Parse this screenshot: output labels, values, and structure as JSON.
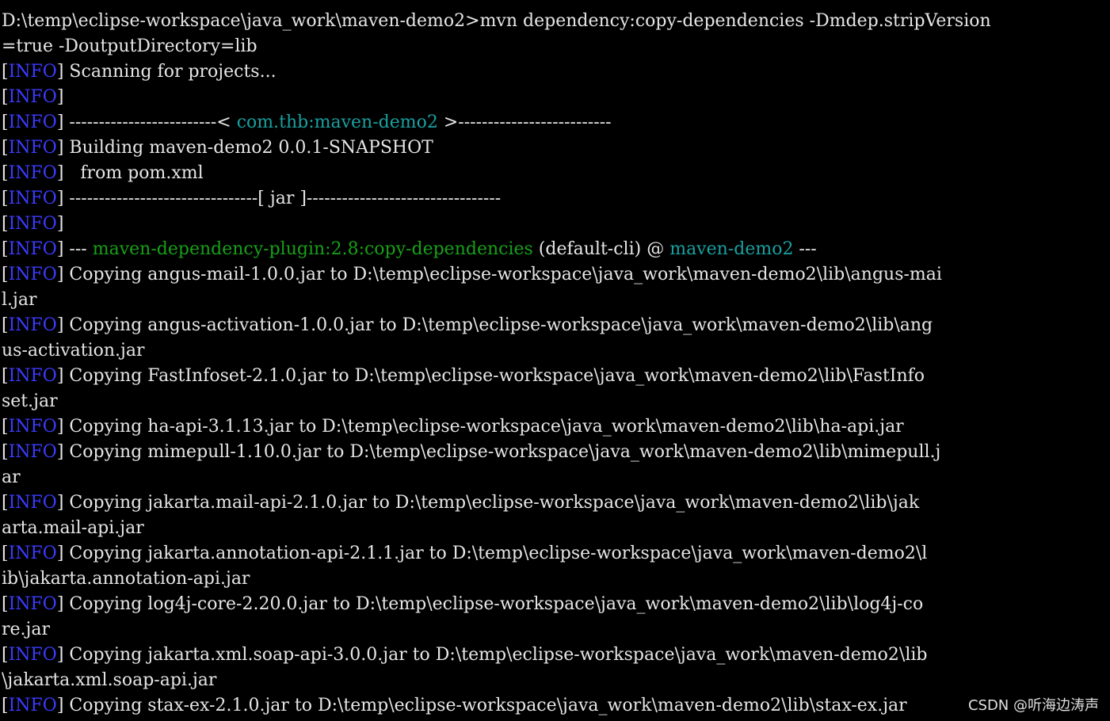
{
  "colors": {
    "background": "#000000",
    "text": "#e6e6e6",
    "info_tag": "#3b3bff",
    "project_id": "#1aa0a0",
    "plugin": "#18a018"
  },
  "terminal": {
    "command": "D:\\temp\\eclipse-workspace\\java_work\\maven-demo2>mvn dependency:copy-dependencies -Dmdep.stripVersion",
    "command_wrap": "=true -DoutputDirectory=lib",
    "info_label": "INFO",
    "scanning": " Scanning for projects...",
    "project_line": {
      "left_rule": " -------------------------< ",
      "project_id": "com.thb:maven-demo2",
      "right_rule": " >--------------------------"
    },
    "building": " Building maven-demo2 0.0.1-SNAPSHOT",
    "from_pom": "   from pom.xml",
    "packaging_line": " --------------------------------[ jar ]---------------------------------",
    "plugin_line": {
      "prefix": " --- ",
      "plugin": "maven-dependency-plugin:2.8:copy-dependencies",
      "middle": " (default-cli) @ ",
      "project": "maven-demo2",
      "suffix": " ---"
    },
    "copy_lines": [
      {
        "text": " Copying angus-mail-1.0.0.jar to D:\\temp\\eclipse-workspace\\java_work\\maven-demo2\\lib\\angus-mai",
        "wrap": "l.jar"
      },
      {
        "text": " Copying angus-activation-1.0.0.jar to D:\\temp\\eclipse-workspace\\java_work\\maven-demo2\\lib\\ang",
        "wrap": "us-activation.jar"
      },
      {
        "text": " Copying FastInfoset-2.1.0.jar to D:\\temp\\eclipse-workspace\\java_work\\maven-demo2\\lib\\FastInfo",
        "wrap": "set.jar"
      },
      {
        "text": " Copying ha-api-3.1.13.jar to D:\\temp\\eclipse-workspace\\java_work\\maven-demo2\\lib\\ha-api.jar",
        "wrap": ""
      },
      {
        "text": " Copying mimepull-1.10.0.jar to D:\\temp\\eclipse-workspace\\java_work\\maven-demo2\\lib\\mimepull.j",
        "wrap": "ar"
      },
      {
        "text": " Copying jakarta.mail-api-2.1.0.jar to D:\\temp\\eclipse-workspace\\java_work\\maven-demo2\\lib\\jak",
        "wrap": "arta.mail-api.jar"
      },
      {
        "text": " Copying jakarta.annotation-api-2.1.1.jar to D:\\temp\\eclipse-workspace\\java_work\\maven-demo2\\l",
        "wrap": "ib\\jakarta.annotation-api.jar"
      },
      {
        "text": " Copying log4j-core-2.20.0.jar to D:\\temp\\eclipse-workspace\\java_work\\maven-demo2\\lib\\log4j-co",
        "wrap": "re.jar"
      },
      {
        "text": " Copying jakarta.xml.soap-api-3.0.0.jar to D:\\temp\\eclipse-workspace\\java_work\\maven-demo2\\lib",
        "wrap": "\\jakarta.xml.soap-api.jar"
      },
      {
        "text": " Copying stax-ex-2.1.0.jar to D:\\temp\\eclipse-workspace\\java_work\\maven-demo2\\lib\\stax-ex.jar",
        "wrap": ""
      }
    ]
  },
  "watermark": "CSDN @听海边涛声"
}
